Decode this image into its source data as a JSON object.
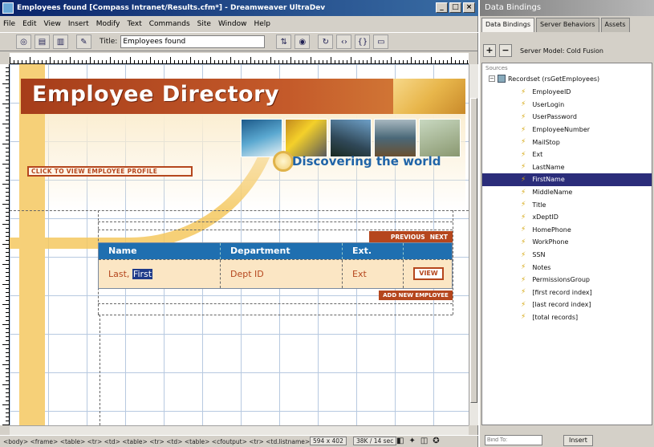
{
  "window": {
    "title": "Employees found [Compass Intranet/Results.cfm*] - Dreamweaver UltraDev",
    "minimize": "_",
    "maximize": "□",
    "close": "×"
  },
  "menu": [
    "File",
    "Edit",
    "View",
    "Insert",
    "Modify",
    "Text",
    "Commands",
    "Site",
    "Window",
    "Help"
  ],
  "toolbar": {
    "title_label": "Title:",
    "title_value": "Employees found"
  },
  "page": {
    "heading": "Employee Directory",
    "tagline": "Discovering the world",
    "profile_link": "CLICK TO VIEW EMPLOYEE PROFILE",
    "previous": "PREVIOUS",
    "next": "NEXT",
    "add_employee": "ADD NEW EMPLOYEE",
    "table": {
      "headers": [
        "Name",
        "Department",
        "Ext."
      ],
      "row": {
        "name_last": "Last,",
        "name_first": "First",
        "department": "Dept ID",
        "ext": "Ext",
        "view": "VIEW"
      }
    }
  },
  "status": {
    "tags": "<body> <frame> <table> <tr> <td> <table> <tr> <td> <table> <cfoutput> <tr> <td.listname>",
    "size": "594 x 402",
    "time": "38K / 14 sec"
  },
  "panel": {
    "title": "Data Bindings",
    "tabs": [
      "Data Bindings",
      "Server Behaviors",
      "Assets"
    ],
    "add": "+",
    "remove": "−",
    "server_model": "Server Model: Cold Fusion",
    "caption": "Sources",
    "recordset": "Recordset (rsGetEmployees)",
    "fields": [
      "EmployeeID",
      "UserLogin",
      "UserPassword",
      "EmployeeNumber",
      "MailStop",
      "Ext",
      "LastName",
      "FirstName",
      "MiddleName",
      "Title",
      "xDeptID",
      "HomePhone",
      "WorkPhone",
      "SSN",
      "Notes",
      "PermissionsGroup",
      "[first record index]",
      "[last record index]",
      "[total records]"
    ],
    "selected_field": "FirstName",
    "bind_to_placeholder": "Bind To:",
    "insert": "Insert"
  }
}
